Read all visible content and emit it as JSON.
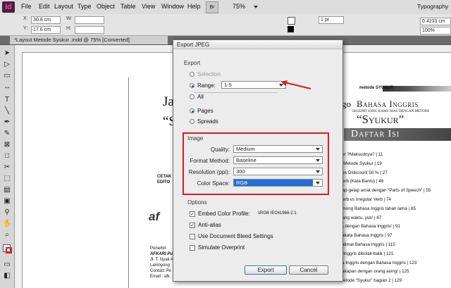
{
  "app": {
    "icon_label": "Id",
    "menu": [
      "File",
      "Edit",
      "Layout",
      "Type",
      "Object",
      "Table",
      "View",
      "Window",
      "Help"
    ],
    "zoom": "75%",
    "workspace": "Typography"
  },
  "control": {
    "x_label": "X:",
    "x_value": "30.8 cm",
    "y_label": "Y:",
    "y_value": "17.6 cm",
    "w_label": "W:",
    "h_label": "H:",
    "stroke_weight": "1 pt",
    "width_field": "0.4233 cm",
    "zoom_field": "100%"
  },
  "document_tab": "*Layout Metode Syukur .indd @ 75% [Converted]",
  "dialog": {
    "title": "Export JPEG",
    "export_heading": "Export",
    "selection_label": "Selection",
    "range_label": "Range:",
    "range_value": "1-5",
    "all_label": "All",
    "pages_label": "Pages",
    "spreads_label": "Spreads",
    "image_heading": "Image",
    "quality_label": "Quality:",
    "quality_value": "Medium",
    "format_label": "Format Method:",
    "format_value": "Baseline",
    "resolution_label": "Resolution (ppi):",
    "resolution_value": "300",
    "colorspace_label": "Color Space:",
    "colorspace_value": "RGB",
    "options_heading": "Options",
    "embed_label": "Embed Color Profile:",
    "embed_profile": "sRGB IEC61966-2.1",
    "antialias_label": "Anti-alias",
    "bleed_label": "Use Document Bleed Settings",
    "overprint_label": "Simulate Overprint",
    "export_button": "Export",
    "cancel_button": "Cancel"
  },
  "page_left": {
    "title_fragment": "Jag",
    "quote_fragment": "“S",
    "credit1": "CETAK",
    "credit2": "EDITO",
    "publisher": "Penerbit",
    "publisher_name": "AFKARI Pu",
    "address1": "Jl. T. Nyak A",
    "address2": "Lamnyong",
    "contact": "Contact Pe",
    "email": "Email : afk"
  },
  "page_right": {
    "header_small": "metode SYUKUR",
    "title_fragment": "go",
    "title": "Bahasa Inggris",
    "subtitle": "SECEPAT YANG KAMU MAU DENGAN METODE",
    "syukur": "“Syukur”",
    "toc_heading": "Daftar Isi",
    "toc": [
      "kur ?Maksudnya? | 11",
      "a Metode Syukur | 19",
      "ges Diskcount 50 % | 27",
      "Verb (Kata Bantu) | 46",
      "gap-gelap amat dengan “Parts of Speech” | 55",
      "Verb vs Irregular Verb | 74",
      "omong Bahasa Inggris tahan lama | 85",
      "nang waktu, yuk! | 87",
      "ra dengan Bahasa Inggris! | 91",
      "sakata Bahasa Inggris | 97",
      "kalimat Bahasa Inggris | 115",
      "a Inggris dibolak-balik | 121",
      "sa Inggris dengan Bahasa Inggris | 123",
      "cakapan dengan orang asing! | 125",
      "Metode “Syukur” bagian 2 | 129"
    ]
  },
  "colors": {
    "accent_red": "#e0191f",
    "selected_blue": "#1f6fd6",
    "app_icon": "#ff3f9f"
  }
}
